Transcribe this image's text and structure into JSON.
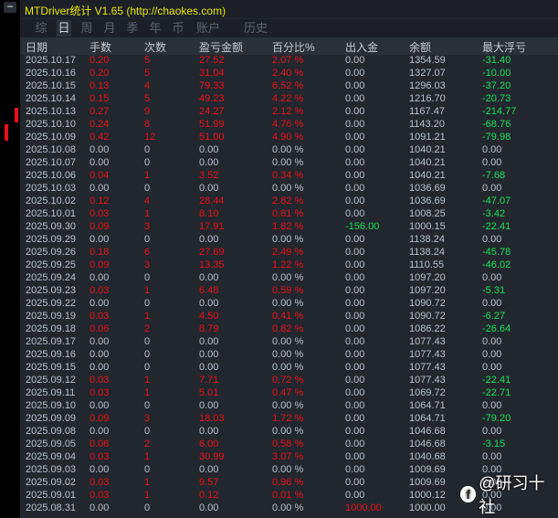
{
  "title": "MTDriver统计 V1.65  (http://chaokes.com)",
  "minimize_label": "−",
  "tabs": [
    "综",
    "日",
    "周",
    "月",
    "季",
    "年",
    "币",
    "账户",
    "历史"
  ],
  "active_tab": "日",
  "columns": [
    "日期",
    "手数",
    "次数",
    "盈亏金额",
    "百分比%",
    "出入金",
    "余额",
    "最大浮亏"
  ],
  "rows": [
    [
      "2025.10.17",
      "0.20",
      "5",
      "27.52",
      "2.07 %",
      "0.00",
      "1354.59",
      "-31.40"
    ],
    [
      "2025.10.16",
      "0.20",
      "5",
      "31.04",
      "2.40 %",
      "0.00",
      "1327.07",
      "-10.00"
    ],
    [
      "2025.10.15",
      "0.13",
      "4",
      "79.33",
      "6.52 %",
      "0.00",
      "1296.03",
      "-37.20"
    ],
    [
      "2025.10.14",
      "0.15",
      "5",
      "49.23",
      "4.22 %",
      "0.00",
      "1216.70",
      "-20.73"
    ],
    [
      "2025.10.13",
      "0.27",
      "9",
      "24.27",
      "2.12 %",
      "0.00",
      "1167.47",
      "-214.77"
    ],
    [
      "2025.10.10",
      "0.24",
      "8",
      "51.99",
      "4.76 %",
      "0.00",
      "1143.20",
      "-68.76"
    ],
    [
      "2025.10.09",
      "0.42",
      "12",
      "51.00",
      "4.90 %",
      "0.00",
      "1091.21",
      "-79.98"
    ],
    [
      "2025.10.08",
      "0.00",
      "0",
      "0.00",
      "0.00 %",
      "0.00",
      "1040.21",
      "0.00"
    ],
    [
      "2025.10.07",
      "0.00",
      "0",
      "0.00",
      "0.00 %",
      "0.00",
      "1040.21",
      "0.00"
    ],
    [
      "2025.10.06",
      "0.04",
      "1",
      "3.52",
      "0.34 %",
      "0.00",
      "1040.21",
      "-7.68"
    ],
    [
      "2025.10.03",
      "0.00",
      "0",
      "0.00",
      "0.00 %",
      "0.00",
      "1036.69",
      "0.00"
    ],
    [
      "2025.10.02",
      "0.12",
      "4",
      "28.44",
      "2.82 %",
      "0.00",
      "1036.69",
      "-47.07"
    ],
    [
      "2025.10.01",
      "0.03",
      "1",
      "8.10",
      "0.81 %",
      "0.00",
      "1008.25",
      "-3.42"
    ],
    [
      "2025.09.30",
      "0.09",
      "3",
      "17.91",
      "1.82 %",
      "-156.00",
      "1000.15",
      "-22.41"
    ],
    [
      "2025.09.29",
      "0.00",
      "0",
      "0.00",
      "0.00 %",
      "0.00",
      "1138.24",
      "0.00"
    ],
    [
      "2025.09.26",
      "0.18",
      "6",
      "27.69",
      "2.49 %",
      "0.00",
      "1138.24",
      "-45.78"
    ],
    [
      "2025.09.25",
      "0.09",
      "3",
      "13.35",
      "1.22 %",
      "0.00",
      "1110.55",
      "-46.02"
    ],
    [
      "2025.09.24",
      "0.00",
      "0",
      "0.00",
      "0.00 %",
      "0.00",
      "1097.20",
      "0.00"
    ],
    [
      "2025.09.23",
      "0.03",
      "1",
      "6.48",
      "0.59 %",
      "0.00",
      "1097.20",
      "-5.31"
    ],
    [
      "2025.09.22",
      "0.00",
      "0",
      "0.00",
      "0.00 %",
      "0.00",
      "1090.72",
      "0.00"
    ],
    [
      "2025.09.19",
      "0.03",
      "1",
      "4.50",
      "0.41 %",
      "0.00",
      "1090.72",
      "-6.27"
    ],
    [
      "2025.09.18",
      "0.06",
      "2",
      "8.79",
      "0.82 %",
      "0.00",
      "1086.22",
      "-26.64"
    ],
    [
      "2025.09.17",
      "0.00",
      "0",
      "0.00",
      "0.00 %",
      "0.00",
      "1077.43",
      "0.00"
    ],
    [
      "2025.09.16",
      "0.00",
      "0",
      "0.00",
      "0.00 %",
      "0.00",
      "1077.43",
      "0.00"
    ],
    [
      "2025.09.15",
      "0.00",
      "0",
      "0.00",
      "0.00 %",
      "0.00",
      "1077.43",
      "0.00"
    ],
    [
      "2025.09.12",
      "0.03",
      "1",
      "7.71",
      "0.72 %",
      "0.00",
      "1077.43",
      "-22.41"
    ],
    [
      "2025.09.11",
      "0.03",
      "1",
      "5.01",
      "0.47 %",
      "0.00",
      "1069.72",
      "-22.71"
    ],
    [
      "2025.09.10",
      "0.00",
      "0",
      "0.00",
      "0.00 %",
      "0.00",
      "1064.71",
      "0.00"
    ],
    [
      "2025.09.09",
      "0.09",
      "3",
      "18.03",
      "1.72 %",
      "0.00",
      "1064.71",
      "-79.20"
    ],
    [
      "2025.09.08",
      "0.00",
      "0",
      "0.00",
      "0.00 %",
      "0.00",
      "1046.68",
      "0.00"
    ],
    [
      "2025.09.05",
      "0.06",
      "2",
      "6.00",
      "0.58 %",
      "0.00",
      "1046.68",
      "-3.15"
    ],
    [
      "2025.09.04",
      "0.03",
      "1",
      "30.99",
      "3.07 %",
      "0.00",
      "1040.68",
      "0.00"
    ],
    [
      "2025.09.03",
      "0.00",
      "0",
      "0.00",
      "0.00 %",
      "0.00",
      "1009.69",
      "0.00"
    ],
    [
      "2025.09.02",
      "0.03",
      "1",
      "9.57",
      "0.96 %",
      "0.00",
      "1009.69",
      "0.00"
    ],
    [
      "2025.09.01",
      "0.03",
      "1",
      "0.12",
      "0.01 %",
      "0.00",
      "1000.12",
      "0.00"
    ],
    [
      "2025.08.31",
      "0.00",
      "0",
      "0.00",
      "0.00 %",
      "1000.00",
      "1000.00",
      "0.00"
    ]
  ],
  "watermark": "@研习十社",
  "colors": {
    "profit": "#e8101a",
    "loss_float": "#19e05c",
    "neutral": "#b7c2d0",
    "title": "#e8e800"
  }
}
